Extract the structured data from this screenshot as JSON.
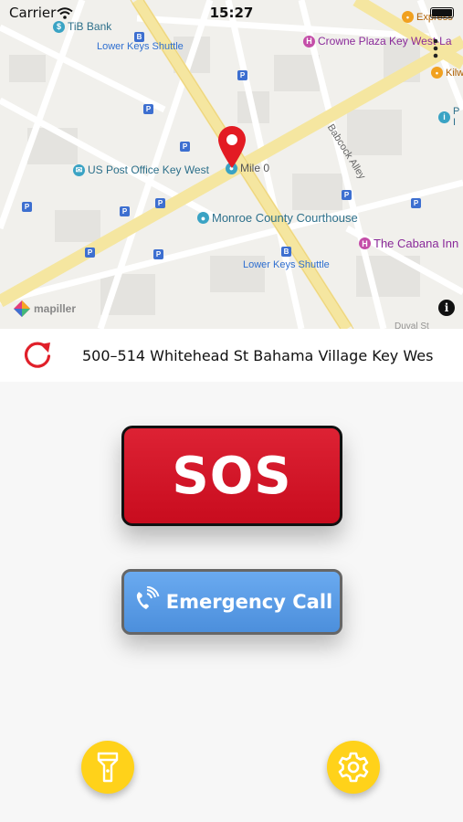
{
  "status": {
    "carrier": "Carrier",
    "time": "15:27"
  },
  "map": {
    "pois": {
      "tib_bank": "TiB Bank",
      "lower_keys_shuttle_top": "Lower Keys Shuttle",
      "crowne_plaza": "Crowne Plaza Key West-La",
      "express": "Express",
      "kilw": "Kilw",
      "pa_partial": "P",
      "in_partial": "I",
      "us_post_office": "US Post Office Key West",
      "mile_0": "Mile 0",
      "babcock_alley": "Babcock Alley",
      "monroe_courthouse": "Monroe County Courthouse",
      "cabana_inn": "The Cabana Inn",
      "lower_keys_shuttle_bottom": "Lower Keys Shuttle",
      "bottom_right_partial": "Duval St"
    },
    "logo_text": "mapiller",
    "info_glyph": "i"
  },
  "address": {
    "text": "500–514 Whitehead St Bahama Village Key West"
  },
  "buttons": {
    "sos_label": "SOS",
    "call_label": "Emergency Call"
  },
  "colors": {
    "sos_red": "#d0142a",
    "call_blue": "#5a9be6",
    "accent_yellow": "#ffd21a",
    "refresh_red": "#e0202a"
  },
  "icons": [
    "wifi-icon",
    "battery-icon",
    "more-icon",
    "map-pin-icon",
    "refresh-icon",
    "phone-icon",
    "flashlight-icon",
    "gear-icon",
    "info-icon"
  ]
}
